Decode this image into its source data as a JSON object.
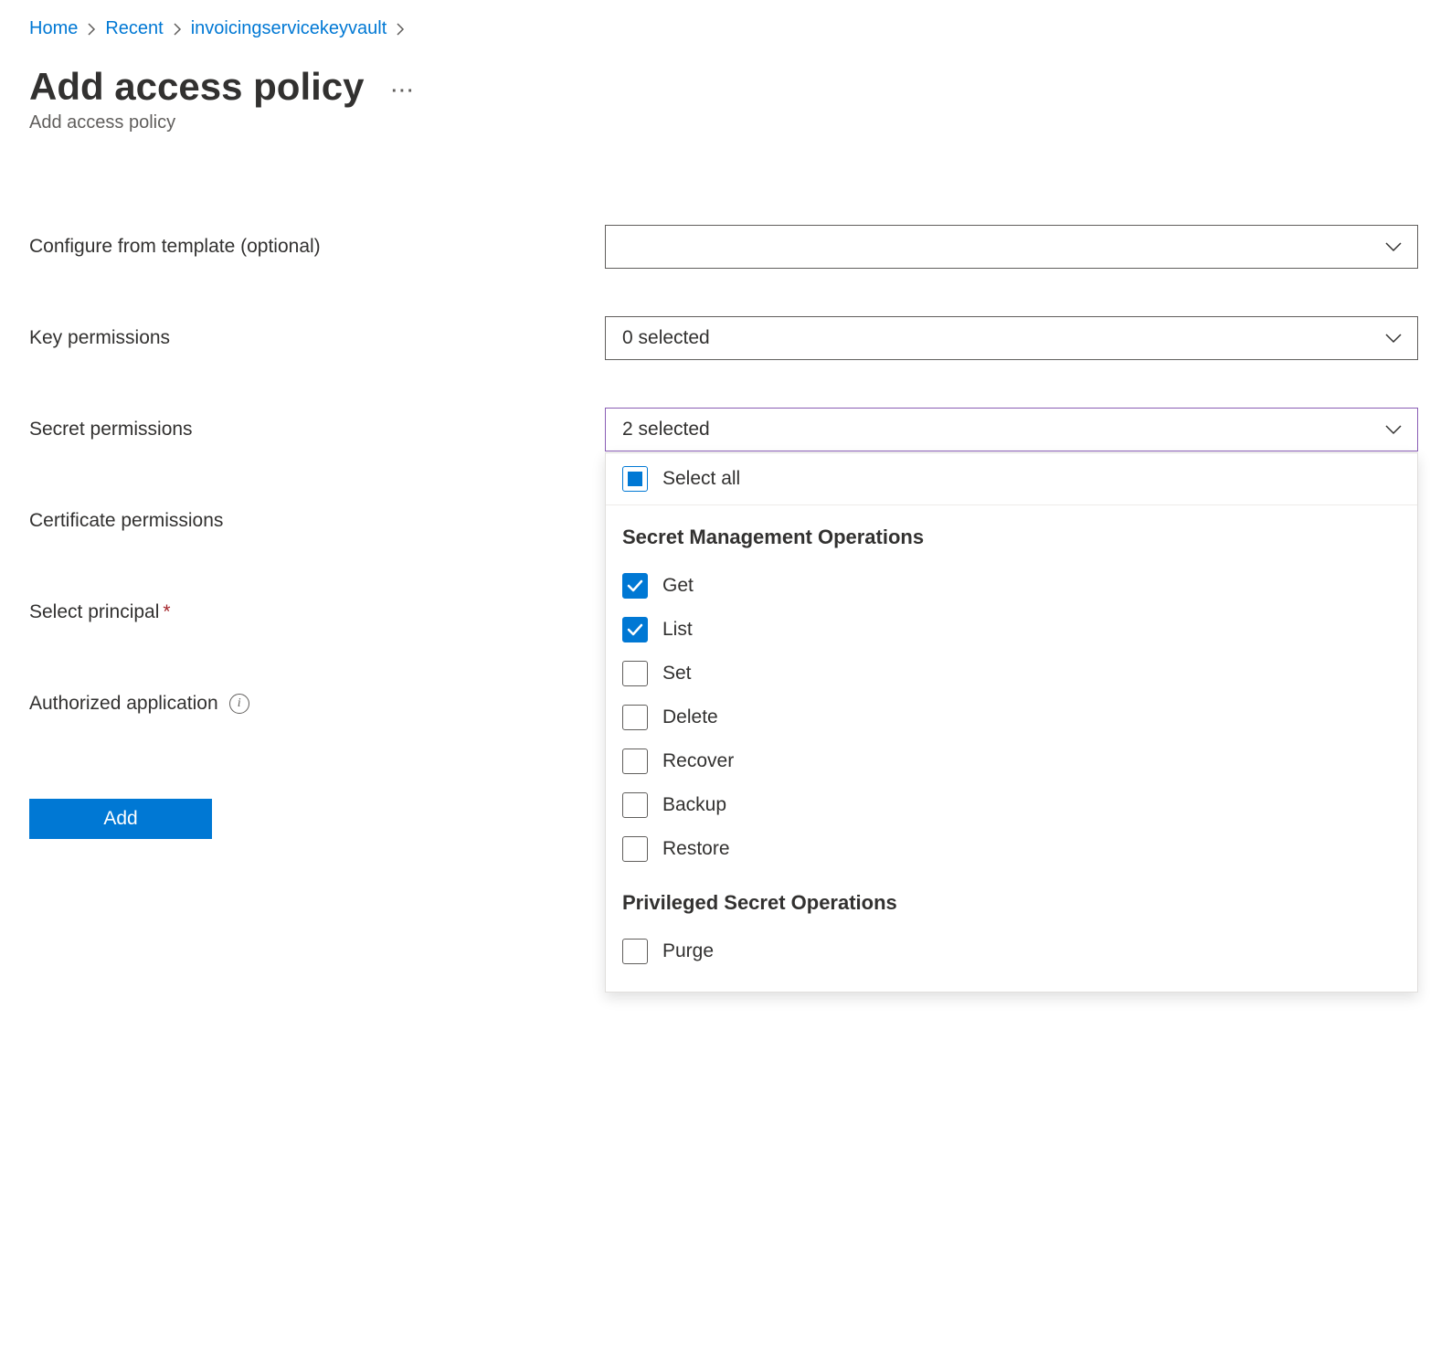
{
  "breadcrumb": {
    "items": [
      {
        "label": "Home"
      },
      {
        "label": "Recent"
      },
      {
        "label": "invoicingservicekeyvault"
      }
    ]
  },
  "header": {
    "title": "Add access policy",
    "subtitle": "Add access policy"
  },
  "form": {
    "template_label": "Configure from template (optional)",
    "template_value": "",
    "key_label": "Key permissions",
    "key_value": "0 selected",
    "secret_label": "Secret permissions",
    "secret_value": "2 selected",
    "cert_label": "Certificate permissions",
    "principal_label": "Select principal",
    "authapp_label": "Authorized application",
    "add_button": "Add"
  },
  "secret_dropdown": {
    "select_all_label": "Select all",
    "select_all_state": "indeterminate",
    "groups": [
      {
        "heading": "Secret Management Operations",
        "options": [
          {
            "label": "Get",
            "checked": true
          },
          {
            "label": "List",
            "checked": true
          },
          {
            "label": "Set",
            "checked": false
          },
          {
            "label": "Delete",
            "checked": false
          },
          {
            "label": "Recover",
            "checked": false
          },
          {
            "label": "Backup",
            "checked": false
          },
          {
            "label": "Restore",
            "checked": false
          }
        ]
      },
      {
        "heading": "Privileged Secret Operations",
        "options": [
          {
            "label": "Purge",
            "checked": false
          }
        ]
      }
    ]
  },
  "colors": {
    "link": "#0078d4",
    "primary": "#0078d4",
    "open_border": "#8a5db5",
    "text": "#323130",
    "muted": "#605e5c",
    "danger": "#a4262c"
  }
}
